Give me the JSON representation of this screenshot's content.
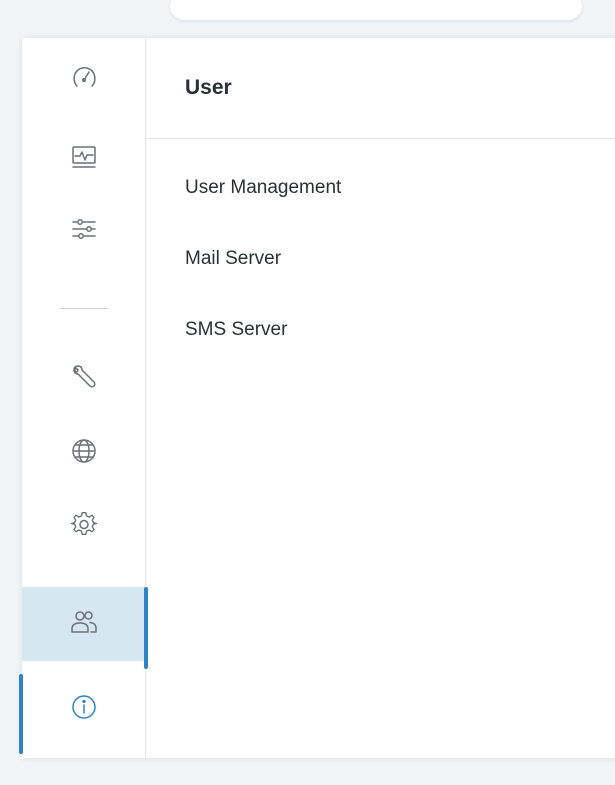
{
  "content": {
    "title": "User",
    "menu": [
      {
        "label": "User Management"
      },
      {
        "label": "Mail Server"
      },
      {
        "label": "SMS Server"
      }
    ]
  },
  "rail": {
    "items": [
      {
        "icon": "speedometer-icon"
      },
      {
        "icon": "monitor-pulse-icon"
      },
      {
        "icon": "sliders-icon"
      },
      {
        "icon": "wrench-icon"
      },
      {
        "icon": "globe-icon"
      },
      {
        "icon": "gear-icon"
      },
      {
        "icon": "users-icon",
        "active": true
      },
      {
        "icon": "info-icon"
      }
    ]
  },
  "colors": {
    "accent": "#2f83c5",
    "active_bg": "#d7e7f1",
    "icon": "#6b7178",
    "text": "#2b2f36"
  }
}
